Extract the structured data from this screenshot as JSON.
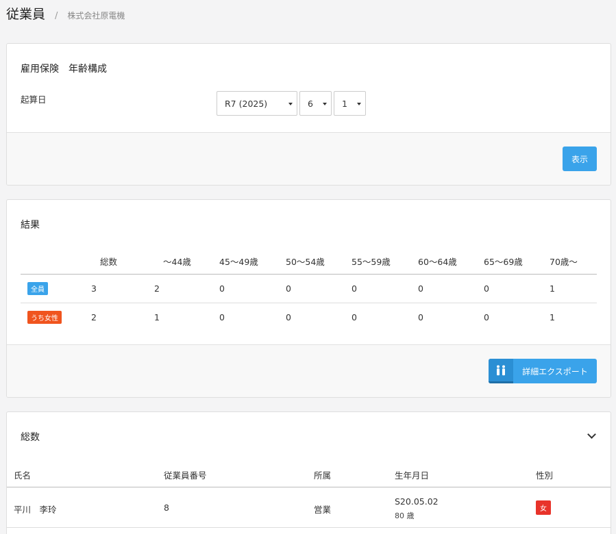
{
  "header": {
    "title": "従業員",
    "separator": "/",
    "company": "株式会社原電機"
  },
  "filter": {
    "title": "雇用保険　年齢構成",
    "start_date_label": "起算日",
    "year_value": "R7 (2025)",
    "month_value": "6",
    "day_value": "1",
    "show_button": "表示"
  },
  "results": {
    "title": "結果",
    "columns": [
      "総数",
      "〜44歳",
      "45〜49歳",
      "50〜54歳",
      "55〜59歳",
      "60〜64歳",
      "65〜69歳",
      "70歳〜"
    ],
    "rows": [
      {
        "label": "全員",
        "values": [
          "3",
          "2",
          "0",
          "0",
          "0",
          "0",
          "0",
          "1"
        ]
      },
      {
        "label": "うち女性",
        "values": [
          "2",
          "1",
          "0",
          "0",
          "0",
          "0",
          "0",
          "1"
        ]
      }
    ],
    "export_button": "詳細エクスポート",
    "export_icon": "people-icon"
  },
  "total": {
    "title": "総数",
    "columns": {
      "name": "氏名",
      "number": "従業員番号",
      "dept": "所属",
      "birth": "生年月日",
      "gender": "性別"
    },
    "employee": {
      "name": "平川　李玲",
      "number": "8",
      "dept": "営業",
      "birth_date": "S20.05.02",
      "age": "80 歳",
      "gender": "女"
    }
  },
  "colors": {
    "primary": "#3aa3ea",
    "female_badge": "#f0541e",
    "gender_badge": "#e8332a"
  }
}
